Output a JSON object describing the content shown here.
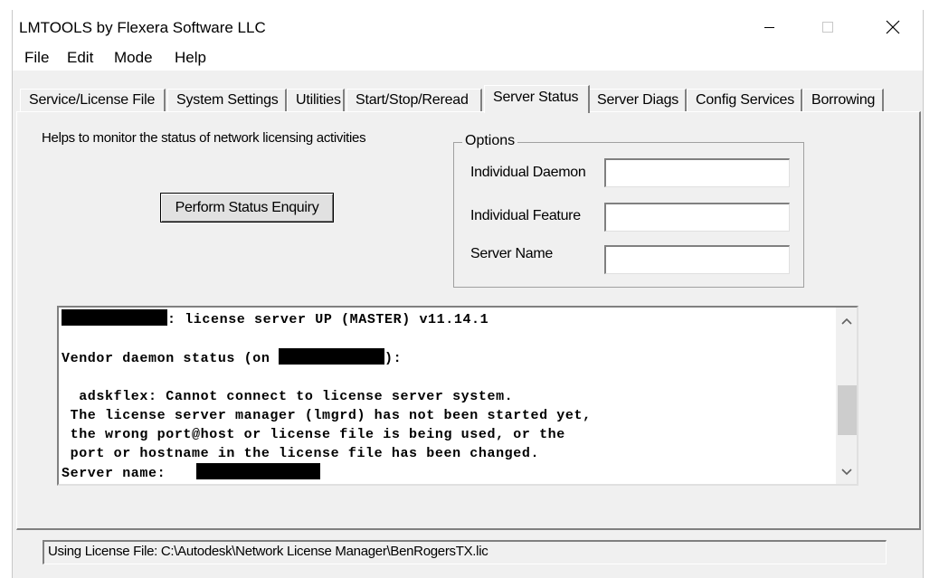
{
  "window": {
    "title": "LMTOOLS by Flexera Software LLC"
  },
  "menu": [
    "File",
    "Edit",
    "Mode",
    "Help"
  ],
  "tabs": [
    {
      "label": "Service/License File",
      "active": false
    },
    {
      "label": "System Settings",
      "active": false
    },
    {
      "label": "Utilities",
      "active": false
    },
    {
      "label": "Start/Stop/Reread",
      "active": false
    },
    {
      "label": "Server Status",
      "active": true
    },
    {
      "label": "Server Diags",
      "active": false
    },
    {
      "label": "Config Services",
      "active": false
    },
    {
      "label": "Borrowing",
      "active": false
    }
  ],
  "server_status": {
    "help_text": "Helps to monitor the status of network licensing activities",
    "perform_button": "Perform Status Enquiry",
    "options": {
      "legend": "Options",
      "daemon_label": "Individual Daemon",
      "daemon_value": "",
      "feature_label": "Individual Feature",
      "feature_value": "",
      "server_label": "Server Name",
      "server_value": ""
    },
    "output": {
      "line1": ": license server UP (MASTER) v11.14.1",
      "line2_prefix": "Vendor daemon status (on ",
      "line2_suffix": "):",
      "line3": "  adskflex: Cannot connect to license server system.",
      "line4": " The license server manager (lmgrd) has not been started yet,",
      "line5": " the wrong port@host or license file is being used, or the",
      "line6": " port or hostname in the license file has been changed.",
      "line7": "Server name:"
    }
  },
  "status_bar": {
    "text": "Using License File:  C:\\Autodesk\\Network License Manager\\BenRogersTX.lic"
  },
  "colors": {
    "face": "#f0f0f0",
    "shadow": "#808080",
    "highlight": "#ffffff",
    "redaction": "#000000"
  }
}
